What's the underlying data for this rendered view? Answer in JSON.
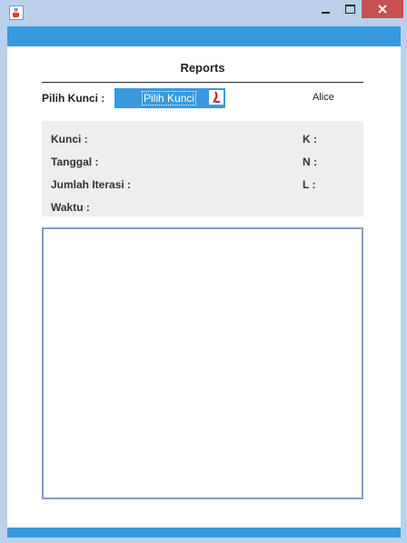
{
  "window": {
    "icon": "java-coffee-icon",
    "controls": [
      "minimize-icon",
      "maximize-icon",
      "close-icon"
    ]
  },
  "header": {
    "title": "Reports"
  },
  "key_selector": {
    "label": "Pilih Kunci :",
    "selected": "Pilih Kunci",
    "arrow_icon": "java-dropdown-icon"
  },
  "user": {
    "name": "Alice"
  },
  "info": {
    "kunci": "Kunci :",
    "tanggal": "Tanggal :",
    "jumlah_iterasi": "Jumlah Iterasi :",
    "waktu": "Waktu :",
    "k": "K :",
    "n": "N :",
    "l": "L :"
  },
  "colors": {
    "accent": "#3a99dc",
    "close_button": "#c75050",
    "panel": "#eeeeee",
    "report_border": "#7e9ec4"
  }
}
